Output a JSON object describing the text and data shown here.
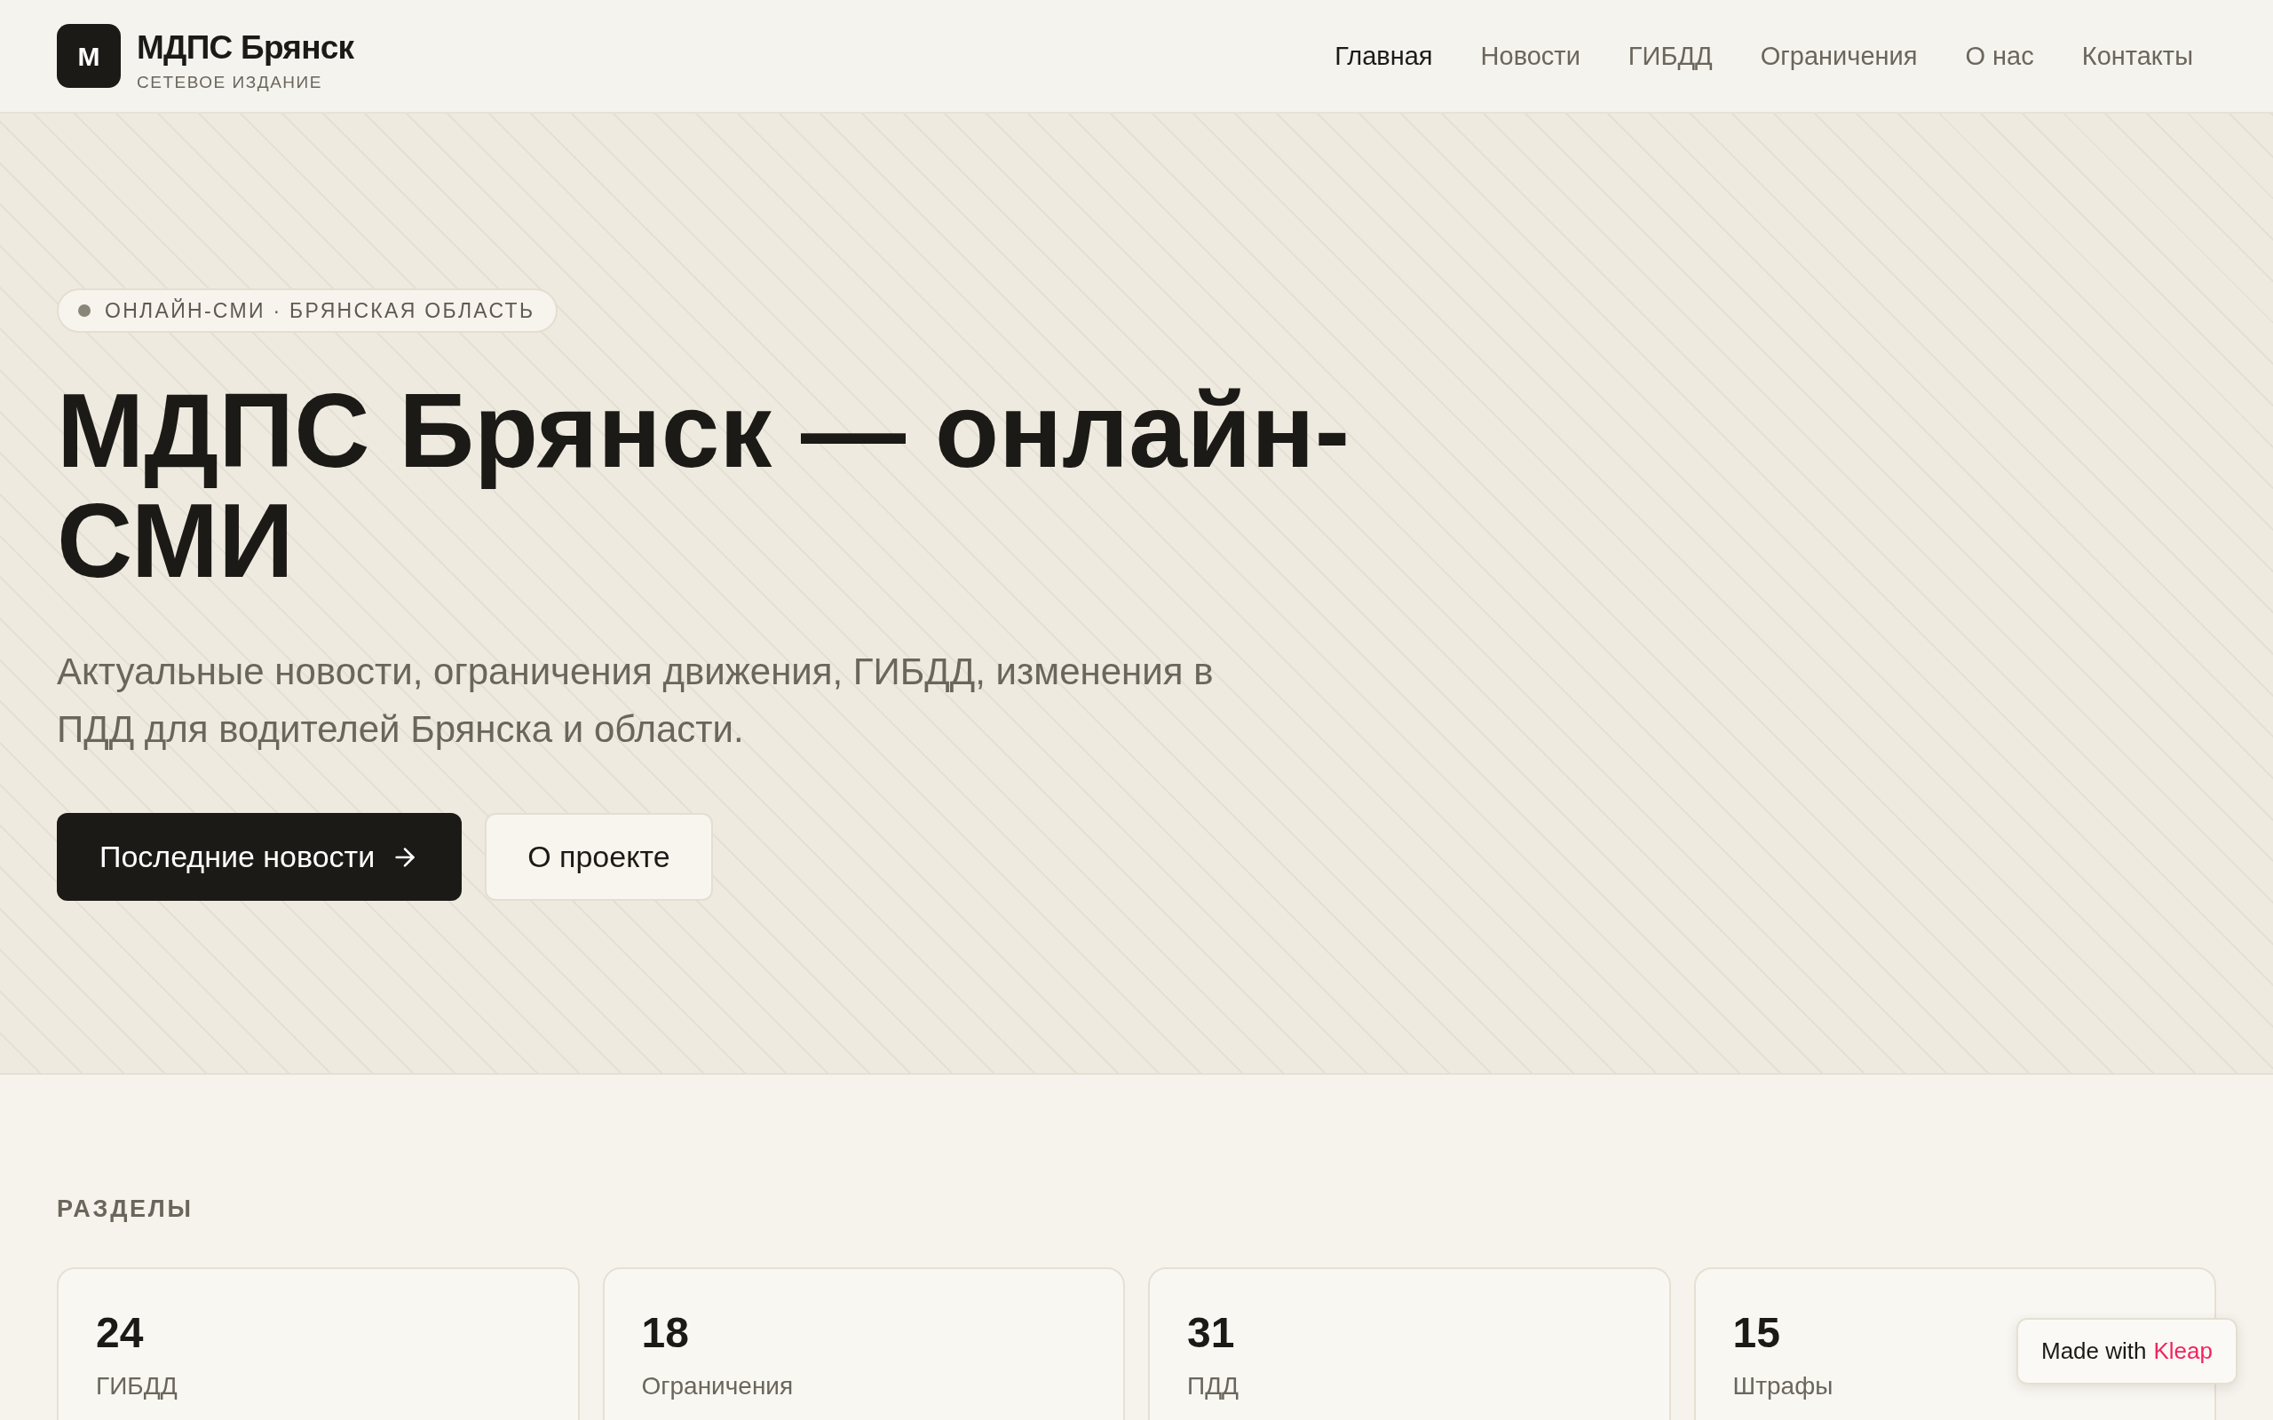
{
  "header": {
    "logo": {
      "letter": "М"
    },
    "title": "МДПС Брянск",
    "subtitle": "СЕТЕВОЕ ИЗДАНИЕ",
    "nav": [
      {
        "label": "Главная",
        "selected": true
      },
      {
        "label": "Новости",
        "selected": false
      },
      {
        "label": "ГИБДД",
        "selected": false
      },
      {
        "label": "Ограничения",
        "selected": false
      },
      {
        "label": "О нас",
        "selected": false
      },
      {
        "label": "Контакты",
        "selected": false
      }
    ]
  },
  "hero": {
    "badge": "ОНЛАЙН-СМИ · БРЯНСКАЯ ОБЛАСТЬ",
    "heading": "МДПС Брянск — онлайн-СМИ",
    "description": "Актуальные новости, ограничения движения, ГИБДД, изменения в ПДД для водителей Брянска и области.",
    "buttons": [
      {
        "label": "Последние новости",
        "kind": "primary"
      },
      {
        "label": "О проекте",
        "kind": "secondary"
      }
    ]
  },
  "sections": {
    "heading": "РАЗДЕЛЫ",
    "cards": [
      {
        "count": "24",
        "label": "ГИБДД"
      },
      {
        "count": "18",
        "label": "Ограничения"
      },
      {
        "count": "31",
        "label": "ПДД"
      },
      {
        "count": "15",
        "label": "Штрафы"
      }
    ]
  },
  "made_with": {
    "text": "Made with",
    "brand": "Kleap"
  }
}
